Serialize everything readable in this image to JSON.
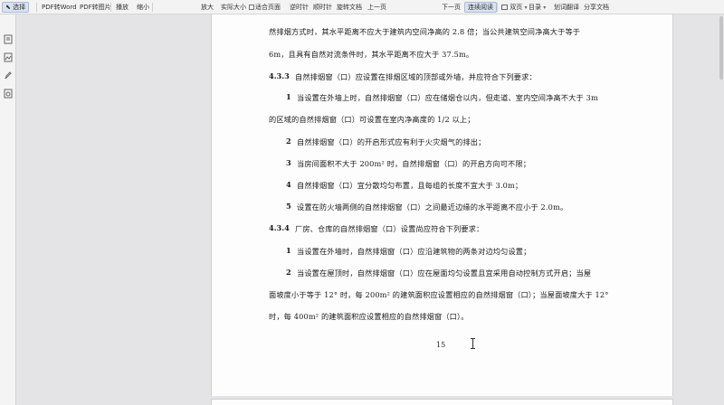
{
  "toolbar": {
    "select_label": "选择",
    "pdf_to_word": "PDF转Word",
    "pdf_to_image": "PDF转图片",
    "play": "播放",
    "zoom_out": "缩小",
    "zoom_in": "放大",
    "actual_size": "实际大小",
    "fit_page": "适合页面",
    "rotate_ccw": "逆时针",
    "rotate_cw": "顺时针",
    "rotate_doc": "旋转文档",
    "prev_page": "上一页",
    "next_page": "下一页",
    "continuous_read": "连续阅读",
    "dual_page": "双页",
    "toc": "目录",
    "translate": "划词翻译",
    "share": "分享文档"
  },
  "document": {
    "line_top": "然排烟方式时，其水平距离不应大于建筑内空间净高的 2.8 倍；当公共建筑空间净高大于等于",
    "line_top2": "6m，且具有自然对流条件时，其水平距离不应大于 37.5m。",
    "s433_num": "4.3.3",
    "s433_text": "自然排烟窗（口）应设置在排烟区域的顶部或外墙，并应符合下列要求：",
    "i1_num": "1",
    "i1_a": "当设置在外墙上时，自然排烟窗（口）应在储烟仓以内，但走道、室内空间净高不大于 3m",
    "i1_b": "的区域的自然排烟窗（口）可设置在室内净高度的 1/2 以上；",
    "i2_num": "2",
    "i2_text": "自然排烟窗（口）的开启形式应有利于火灾烟气的排出；",
    "i3_num": "3",
    "i3_text": "当房间面积不大于 200m² 时，自然排烟窗（口）的开启方向可不限；",
    "i4_num": "4",
    "i4_text": "自然排烟窗（口）宜分散均匀布置，且每组的长度不宜大于 3.0m；",
    "i5_num": "5",
    "i5_text": "设置在防火墙两侧的自然排烟窗（口）之间最近边缘的水平距离不应小于 2.0m。",
    "s434_num": "4.3.4",
    "s434_text": "厂房、仓库的自然排烟窗（口）设置尚应符合下列要求：",
    "j1_num": "1",
    "j1_text": "当设置在外墙时，自然排烟窗（口）应沿建筑物的两条对边均匀设置；",
    "j2_num": "2",
    "j2_a": "当设置在屋顶时，自然排烟窗（口）应在屋面均匀设置且宜采用自动控制方式开启；当屋",
    "j2_b": "面坡度小于等于 12° 时，每 200m² 的建筑面积应设置相应的自然排烟窗（口）；当屋面坡度大于 12°",
    "j2_c": "时，每 400m² 的建筑面积应设置相应的自然排烟窗（口）。",
    "page_number": "15"
  }
}
